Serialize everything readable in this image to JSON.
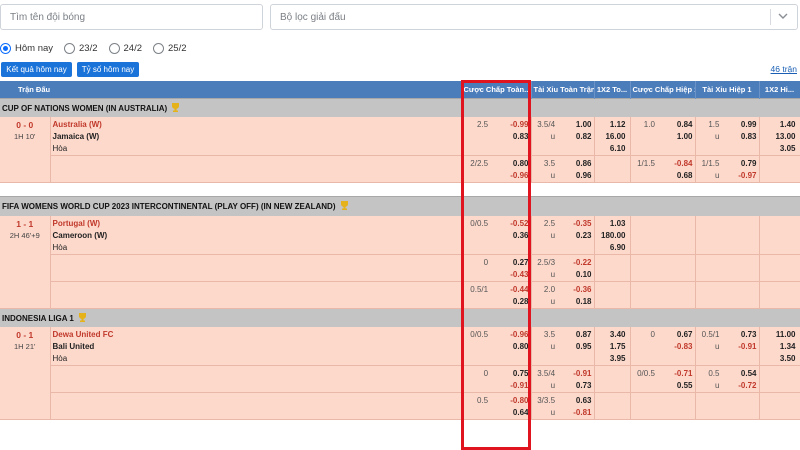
{
  "search": {
    "team_placeholder": "Tìm tên đội bóng",
    "league_placeholder": "Bộ lọc giải đấu"
  },
  "icons": {
    "dropdown": "chevron-down-icon",
    "league_marker": "trophy-icon"
  },
  "colors": {
    "header_bg": "#4c7dbb",
    "league_bg": "#c4c4c4",
    "cell_bg": "#fdd9cc",
    "accent": "#1a73d9",
    "negative": "#c0392b",
    "highlight": "#e0141e"
  },
  "date_filter": {
    "options": [
      "Hôm nay",
      "23/2",
      "24/2",
      "25/2"
    ],
    "selected": "Hôm nay"
  },
  "buttons": {
    "results": "Kết quả hôm nay",
    "scores": "Tỷ số hôm nay"
  },
  "match_count": "46 trận",
  "columns": [
    "Trận Đấu",
    "Cược Chấp Toàn...",
    "Tài Xỉu Toàn Trận",
    "1X2 To...",
    "Cược Chấp Hiệp 1",
    "Tài Xỉu Hiệp 1",
    "1X2 Hi..."
  ],
  "leagues": [
    {
      "name": "CUP OF NATIONS WOMEN (IN AUSTRALIA)",
      "match": {
        "score": "0 - 0",
        "time": "1H 10'",
        "home": "Australia (W)",
        "away": "Jamaica (W)",
        "draw": "Hòa",
        "lines": [
          {
            "ft_hc": "2.5",
            "ft_hc_home": "-0.99",
            "ft_hc_away": "0.83",
            "ft_ou": "3.5/4",
            "ft_o": "1.00",
            "ft_u_label": "u",
            "ft_u": "0.82",
            "ft_1": "1.12",
            "ft_2": "16.00",
            "ft_x": "6.10",
            "h1_hc": "1.0",
            "h1_hc_home": "0.84",
            "h1_hc_away": "1.00",
            "h1_ou": "1.5",
            "h1_o": "0.99",
            "h1_u_label": "u",
            "h1_u": "0.83",
            "h1_1": "1.40",
            "h1_2": "13.00",
            "h1_x": "3.05"
          },
          {
            "ft_hc": "2/2.5",
            "ft_hc_home": "0.80",
            "ft_hc_away": "-0.96",
            "ft_ou": "3.5",
            "ft_o": "0.86",
            "ft_u_label": "u",
            "ft_u": "0.96",
            "h1_hc": "1/1.5",
            "h1_hc_home": "-0.84",
            "h1_hc_away": "0.68",
            "h1_ou": "1/1.5",
            "h1_o": "0.79",
            "h1_u_label": "u",
            "h1_u": "-0.97"
          }
        ]
      }
    },
    {
      "name": "FIFA WOMENS WORLD CUP 2023 INTERCONTINENTAL (PLAY OFF) (IN NEW ZEALAND)",
      "match": {
        "score": "1 - 1",
        "time": "2H 46'+9",
        "home": "Portugal (W)",
        "away": "Cameroon (W)",
        "draw": "Hòa",
        "lines": [
          {
            "ft_hc": "0/0.5",
            "ft_hc_home": "-0.52",
            "ft_hc_away": "0.36",
            "ft_ou": "2.5",
            "ft_o": "-0.35",
            "ft_u_label": "u",
            "ft_u": "0.23",
            "ft_1": "1.03",
            "ft_2": "180.00",
            "ft_x": "6.90"
          },
          {
            "ft_hc": "0",
            "ft_hc_home": "0.27",
            "ft_hc_away": "-0.43",
            "ft_ou": "2.5/3",
            "ft_o": "-0.22",
            "ft_u_label": "u",
            "ft_u": "0.10"
          },
          {
            "ft_hc": "0.5/1",
            "ft_hc_home": "-0.44",
            "ft_hc_away": "0.28",
            "ft_ou": "2.0",
            "ft_o": "-0.36",
            "ft_u_label": "u",
            "ft_u": "0.18"
          }
        ]
      }
    },
    {
      "name": "INDONESIA LIGA 1",
      "match": {
        "score": "0 - 1",
        "time": "1H 21'",
        "home": "Dewa United FC",
        "away": "Bali United",
        "draw": "Hòa",
        "lines": [
          {
            "ft_hc": "0/0.5",
            "ft_hc_home": "-0.96",
            "ft_hc_away": "0.80",
            "ft_ou": "3.5",
            "ft_o": "0.87",
            "ft_u_label": "u",
            "ft_u": "0.95",
            "ft_1": "3.40",
            "ft_2": "1.75",
            "ft_x": "3.95",
            "h1_hc": "0",
            "h1_hc_home": "0.67",
            "h1_hc_away": "-0.83",
            "h1_ou": "0.5/1",
            "h1_o": "0.73",
            "h1_u_label": "u",
            "h1_u": "-0.91",
            "h1_1": "11.00",
            "h1_2": "1.34",
            "h1_x": "3.50"
          },
          {
            "ft_hc": "0",
            "ft_hc_home": "0.75",
            "ft_hc_away": "-0.91",
            "ft_ou": "3.5/4",
            "ft_o": "-0.91",
            "ft_u_label": "u",
            "ft_u": "0.73",
            "h1_hc": "0/0.5",
            "h1_hc_home": "-0.71",
            "h1_hc_away": "0.55",
            "h1_ou": "0.5",
            "h1_o": "0.54",
            "h1_u_label": "u",
            "h1_u": "-0.72"
          },
          {
            "ft_hc": "0.5",
            "ft_hc_home": "-0.80",
            "ft_hc_away": "0.64",
            "ft_ou": "3/3.5",
            "ft_o": "0.63",
            "ft_u_label": "u",
            "ft_u": "-0.81"
          }
        ]
      }
    }
  ]
}
